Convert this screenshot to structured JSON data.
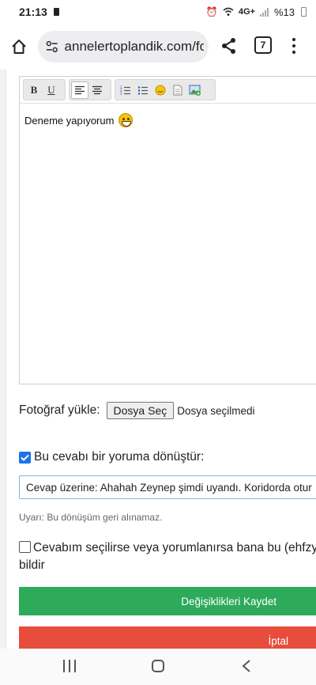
{
  "status_bar": {
    "time": "21:13",
    "network": "4G+",
    "battery": "%13"
  },
  "browser": {
    "url": "annelertoplandik.com/fo",
    "tab_count": "7"
  },
  "editor": {
    "toolbar": {
      "bold": "B",
      "underline": "U"
    },
    "content": "Deneme yapıyorum"
  },
  "photo_upload": {
    "label": "Fotoğraf yükle:",
    "button": "Dosya Seç",
    "status": "Dosya seçilmedi"
  },
  "convert": {
    "label": "Bu cevabı bir yoruma dönüştür:",
    "checked": true,
    "input_value": "Cevap üzerine: Ahahah Zeynep şimdi uyandı. Koridorda otur"
  },
  "warning": "Uyarı: Bu dönüşüm geri alınamaz.",
  "notify": {
    "label": "Cevabım seçilirse veya yorumlanırsa bana bu (ehfzy",
    "label2": "bildir",
    "checked": false
  },
  "buttons": {
    "save": "Değişiklikleri Kaydet",
    "cancel": "İptal"
  },
  "colors": {
    "save": "#2daa5a",
    "cancel": "#e74c3c",
    "checkbox": "#1a73e8"
  }
}
